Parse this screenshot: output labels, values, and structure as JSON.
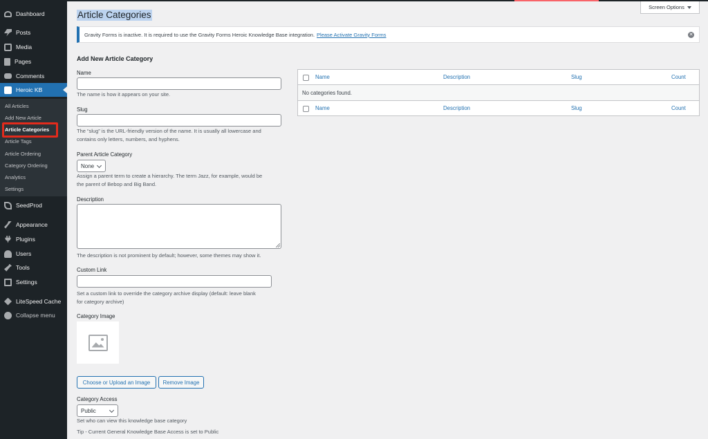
{
  "sidebar": {
    "items": [
      {
        "label": "Dashboard",
        "icon": "dashboard-icon"
      },
      {
        "label": "Posts",
        "icon": "pin-icon"
      },
      {
        "label": "Media",
        "icon": "media-icon"
      },
      {
        "label": "Pages",
        "icon": "page-icon"
      },
      {
        "label": "Comments",
        "icon": "comment-icon"
      },
      {
        "label": "Heroic KB",
        "icon": "kb-icon"
      },
      {
        "label": "SeedProd",
        "icon": "seedprod-icon"
      },
      {
        "label": "Appearance",
        "icon": "brush-icon"
      },
      {
        "label": "Plugins",
        "icon": "plug-icon"
      },
      {
        "label": "Users",
        "icon": "user-icon"
      },
      {
        "label": "Tools",
        "icon": "wrench-icon"
      },
      {
        "label": "Settings",
        "icon": "settings-icon"
      },
      {
        "label": "LiteSpeed Cache",
        "icon": "litespeed-icon"
      },
      {
        "label": "Collapse menu",
        "icon": "collapse-icon"
      }
    ],
    "submenu": [
      "All Articles",
      "Add New Article",
      "Article Categories",
      "Article Tags",
      "Article Ordering",
      "Category Ordering",
      "Analytics",
      "Settings"
    ]
  },
  "header": {
    "title": "Article Categories",
    "screen_options": "Screen Options"
  },
  "notice": {
    "text": "Gravity Forms is inactive. It is required to use the Gravity Forms Heroic Knowledge Base integration.",
    "link": "Please Activate Gravity Forms",
    "dismiss": "✕"
  },
  "form": {
    "title": "Add New Article Category",
    "name_label": "Name",
    "name_help": "The name is how it appears on your site.",
    "slug_label": "Slug",
    "slug_help_1": "The “slug” is the URL-friendly version of the name. It is usually all lowercase and",
    "slug_help_2": "contains only letters, numbers, and hyphens.",
    "parent_label": "Parent Article Category",
    "parent_value": "None",
    "parent_help_1": "Assign a parent term to create a hierarchy. The term Jazz, for example, would be",
    "parent_help_2": "the parent of Bebop and Big Band.",
    "description_label": "Description",
    "description_help": "The description is not prominent by default; however, some themes may show it.",
    "custom_link_label": "Custom Link",
    "custom_link_help_1": "Set a custom link to override the category archive display (default: leave blank",
    "custom_link_help_2": "for category archive)",
    "image_label": "Category Image",
    "upload_button": "Choose or Upload an Image",
    "remove_button": "Remove Image",
    "access_label": "Category Access",
    "access_value": "Public",
    "access_help": "Set who can view this knowledge base category",
    "tip": "Tip - Current General Knowledge Base Access is set to Public"
  },
  "table": {
    "columns": [
      "Name",
      "Description",
      "Slug",
      "Count"
    ],
    "empty": "No categories found."
  },
  "colors": {
    "sidebar_bg": "#1d2327",
    "accent": "#2271b1",
    "highlight": "#e32b1c"
  }
}
